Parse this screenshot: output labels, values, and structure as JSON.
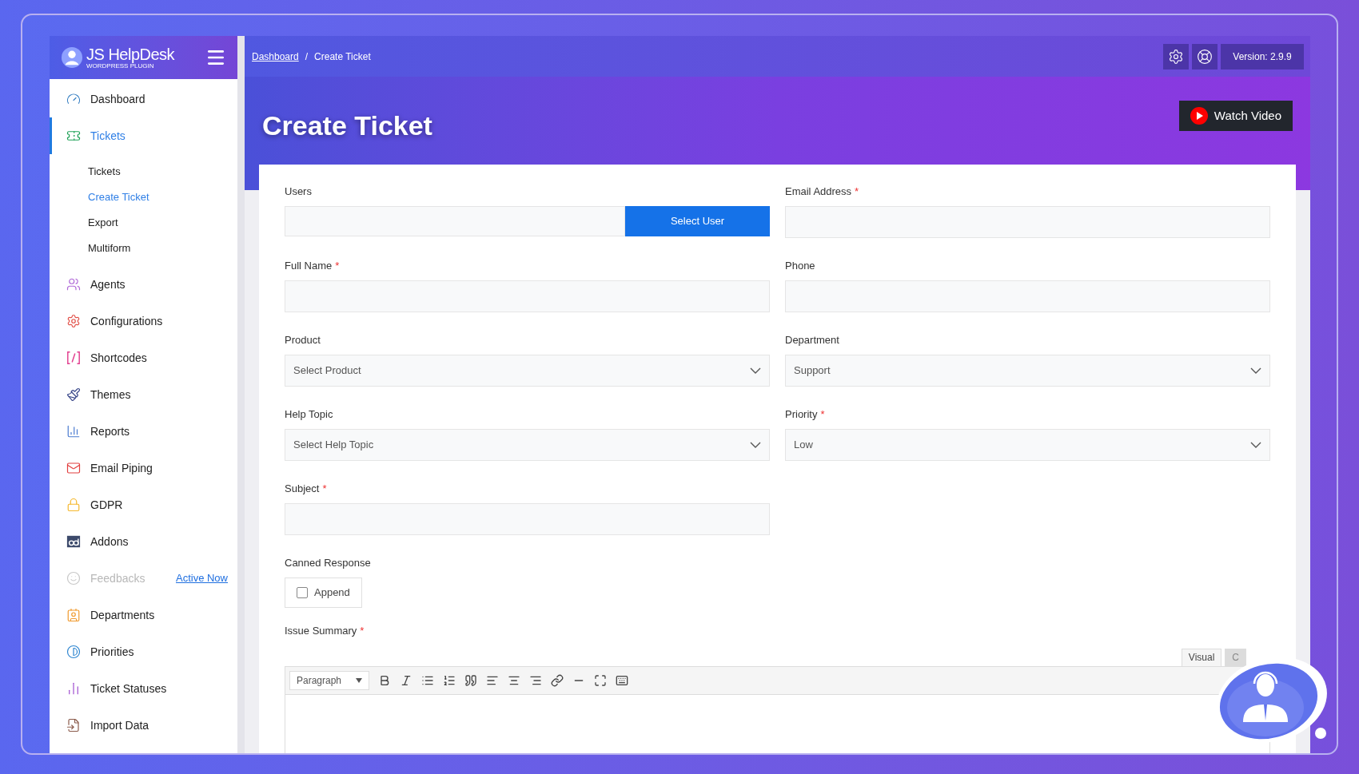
{
  "sidebar": {
    "logo": "JS HelpDesk",
    "logo_sub": "WORDPRESS PLUGIN",
    "items": [
      {
        "label": "Dashboard",
        "selected": false
      },
      {
        "label": "Tickets",
        "selected": true,
        "children": [
          {
            "label": "Tickets",
            "selected": false
          },
          {
            "label": "Create Ticket",
            "selected": true
          },
          {
            "label": "Export",
            "selected": false
          },
          {
            "label": "Multiform",
            "selected": false
          }
        ]
      },
      {
        "label": "Agents",
        "selected": false
      },
      {
        "label": "Configurations",
        "selected": false
      },
      {
        "label": "Shortcodes",
        "selected": false
      },
      {
        "label": "Themes",
        "selected": false
      },
      {
        "label": "Reports",
        "selected": false
      },
      {
        "label": "Email Piping",
        "selected": false
      },
      {
        "label": "GDPR",
        "selected": false
      },
      {
        "label": "Addons",
        "selected": false
      },
      {
        "label": "Feedbacks",
        "selected": false,
        "disabled": true,
        "link": "Active Now"
      },
      {
        "label": "Departments",
        "selected": false
      },
      {
        "label": "Priorities",
        "selected": false
      },
      {
        "label": "Ticket Statuses",
        "selected": false
      },
      {
        "label": "Import Data",
        "selected": false
      }
    ]
  },
  "header": {
    "breadcrumb": [
      {
        "label": "Dashboard",
        "link": true
      },
      {
        "label": "Create Ticket",
        "link": false
      }
    ],
    "separator": "/",
    "version": "Version: 2.9.9"
  },
  "page": {
    "title": "Create Ticket",
    "video_button": "Watch Video"
  },
  "form": {
    "fields": [
      {
        "kind": "user",
        "label": "Users",
        "button": "Select User"
      },
      {
        "kind": "text",
        "label": "Email Address",
        "mark": "*"
      },
      {
        "kind": "text",
        "label": "Full Name",
        "mark": "*"
      },
      {
        "kind": "text",
        "label": "Phone"
      },
      {
        "kind": "select",
        "label": "Product",
        "value": "Select Product"
      },
      {
        "kind": "select",
        "label": "Department",
        "value": "Support"
      },
      {
        "kind": "select",
        "label": "Help Topic",
        "value": "Select Help Topic"
      },
      {
        "kind": "select",
        "label": "Priority",
        "mark": "*",
        "value": "Low"
      },
      {
        "kind": "text",
        "label": "Subject",
        "mark": "*"
      }
    ],
    "canned": {
      "label": "Canned Response",
      "checkbox": "Append",
      "checked": false
    },
    "summary": {
      "label": "Issue Summary",
      "mark": "*",
      "format": "Paragraph",
      "tabs": [
        {
          "label": "Visual",
          "selected": true
        },
        {
          "label": "C",
          "selected": false
        }
      ]
    }
  }
}
